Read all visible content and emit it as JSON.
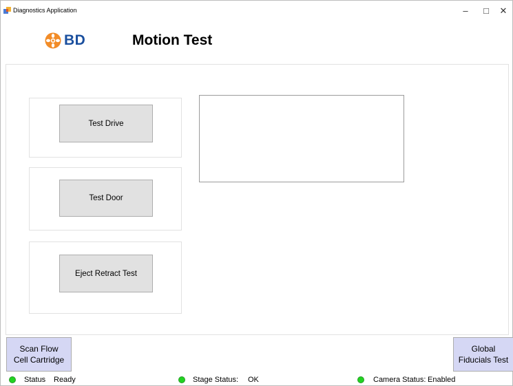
{
  "window": {
    "title": "Diagnostics Application",
    "minimize_glyph": "–",
    "maximize_glyph": "□",
    "close_glyph": "✕"
  },
  "header": {
    "logo_text": "BD",
    "title": "Motion Test"
  },
  "buttons": {
    "test_drive": "Test Drive",
    "test_door": "Test Door",
    "eject_retract": "Eject Retract Test",
    "scan_line1": "Scan Flow",
    "scan_line2": "Cell Cartridge",
    "global_line1": "Global",
    "global_line2": "Fiducials Test"
  },
  "status_bar": {
    "status_label": "Status",
    "status_value": "Ready",
    "stage_label": "Stage Status:",
    "stage_value": "OK",
    "camera_label": "Camera Status:",
    "camera_value": "Enabled"
  },
  "colors": {
    "brand_orange": "#f28c28",
    "brand_blue": "#1a4f9e",
    "led_green": "#21d321",
    "accent_button": "#d5d7f4"
  }
}
